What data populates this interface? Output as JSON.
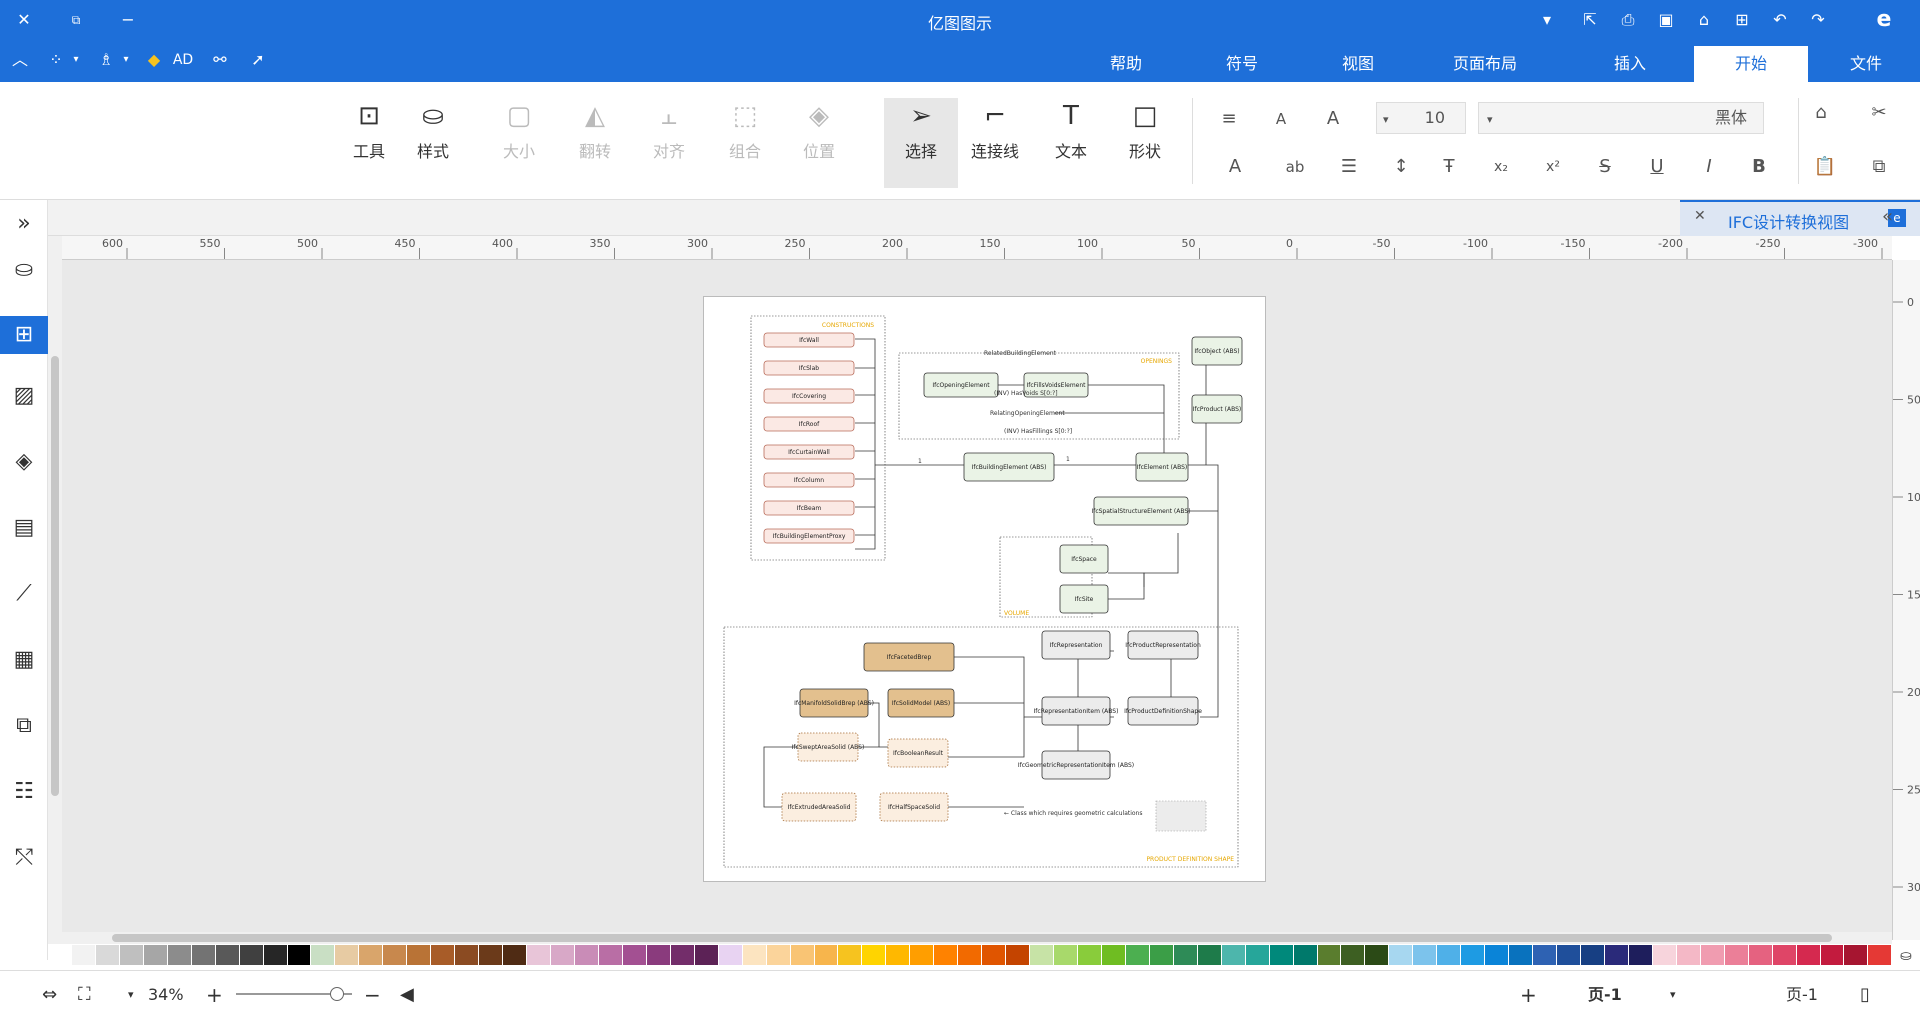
{
  "window": {
    "title": "亿图图示"
  },
  "menu": {
    "tabs": [
      {
        "label": "文件"
      },
      {
        "label": "开始"
      },
      {
        "label": "插入"
      },
      {
        "label": "页面布局"
      },
      {
        "label": "视图"
      },
      {
        "label": "符号"
      },
      {
        "label": "帮助"
      }
    ]
  },
  "quick": {
    "ad_label": "AD"
  },
  "ribbon": {
    "font_name": "黑体",
    "font_size": "10",
    "tools": [
      {
        "label": "形状",
        "icon": "square-icon"
      },
      {
        "label": "文本",
        "icon": "text-icon"
      },
      {
        "label": "连接线",
        "icon": "connector-icon"
      },
      {
        "label": "选择",
        "icon": "select-arrow-icon"
      },
      {
        "label": "位置",
        "icon": "layers-icon"
      },
      {
        "label": "组合",
        "icon": "group-icon"
      },
      {
        "label": "对齐",
        "icon": "align-icon"
      },
      {
        "label": "翻转",
        "icon": "flip-icon"
      },
      {
        "label": "大小",
        "icon": "size-icon"
      },
      {
        "label": "样式",
        "icon": "paint-bucket-icon"
      },
      {
        "label": "工具",
        "icon": "tools-icon"
      }
    ]
  },
  "doc_tab": {
    "label": "IFC设计转换视图"
  },
  "ruler": {
    "h_labels": [
      "-300",
      "-250",
      "-200",
      "-150",
      "-100",
      "-50",
      "0",
      "50",
      "100",
      "150",
      "200",
      "250",
      "300",
      "350",
      "400",
      "450",
      "500",
      "550",
      "600"
    ],
    "v_labels": [
      "0",
      "50",
      "100",
      "150",
      "200",
      "250",
      "300"
    ]
  },
  "status": {
    "page_selector": "页-1",
    "page_tab": "页-1",
    "zoom": "34%"
  },
  "diagram": {
    "group_labels": [
      "CONSTRUCTIONS",
      "OPENINGS",
      "VOLUME",
      "PRODUCT DEFINITION SHAPE"
    ],
    "constructions": [
      "IfcWall",
      "IfcSlab",
      "IfcCovering",
      "IfcRoof",
      "IfcCurtainWall",
      "IfcColumn",
      "IfcBeam",
      "IfcBuildingElementProxy"
    ],
    "openings": [
      "IfcOpeningElement",
      "IfcFillsVoidsElement",
      "RelatedBuildingElement",
      "(INV) HasVoids S[0:?]",
      "RelatingOpeningElement",
      "(INV) HasFillings S[0:?]"
    ],
    "core": [
      "IfcObject (ABS)",
      "IfcProduct (ABS)",
      "IfcElement (ABS)",
      "IfcBuildingElement (ABS)",
      "IfcSpatialStructureElement (ABS)",
      "IfcSpace",
      "IfcSite"
    ],
    "shape": [
      "IfcProductRepresentation",
      "IfcRepresentation",
      "IfcProductDefinitionShape",
      "IfcRepresentationItem (ABS)",
      "IfcGeometricRepresentationItem (ABS)",
      "IfcFacetedBrep",
      "IfcSolidModel (ABS)",
      "IfcManifoldSolidBrep (ABS)",
      "IfcSweptAreaSolid (ABS)",
      "IfcBooleanResult",
      "IfcHalfSpaceSolid",
      "IfcExtrudedAreaSolid"
    ],
    "legend": "← Class which requires geometric calculations",
    "numbers": [
      "1",
      "1"
    ]
  },
  "palette": [
    "#ffffff",
    "#f2f2f2",
    "#d9d9d9",
    "#bfbfbf",
    "#a6a6a6",
    "#8c8c8c",
    "#737373",
    "#595959",
    "#404040",
    "#262626",
    "#000000",
    "#c9dfc4",
    "#e7cba3",
    "#d9a56b",
    "#c8884d",
    "#b97336",
    "#a85c28",
    "#8b4b22",
    "#6b3a1a",
    "#4f2b14",
    "#e8c5d8",
    "#d8a8c7",
    "#c98cb7",
    "#b96ea5",
    "#a35092",
    "#8a3b7d",
    "#732d6a",
    "#5c2256",
    "#e8d3f2",
    "#fce4c0",
    "#fbd49b",
    "#f9c474",
    "#f7b54c",
    "#f6c31f",
    "#ffd400",
    "#ffb800",
    "#ff9e00",
    "#ff8200",
    "#f26a00",
    "#e05500",
    "#c44400",
    "#c7e3a6",
    "#a8d96b",
    "#89cc3b",
    "#6fbd22",
    "#4caf50",
    "#3b9e47",
    "#2e8b57",
    "#1e7b4a",
    "#4db6ac",
    "#26a69a",
    "#00897b",
    "#00796b",
    "#5a7d2e",
    "#3d5f22",
    "#2b4a16",
    "#a7d7f0",
    "#7cc3ec",
    "#4fb0e8",
    "#1e9be3",
    "#0a84d8",
    "#0972be",
    "#2e62b3",
    "#1f4f9b",
    "#173f83",
    "#2a2a7a",
    "#1e1e5c",
    "#f7d4dc",
    "#f4b8c6",
    "#f09cb0",
    "#eb7f98",
    "#e56280",
    "#df4567",
    "#d5294f",
    "#c31b3e",
    "#a61530",
    "#e53935"
  ]
}
